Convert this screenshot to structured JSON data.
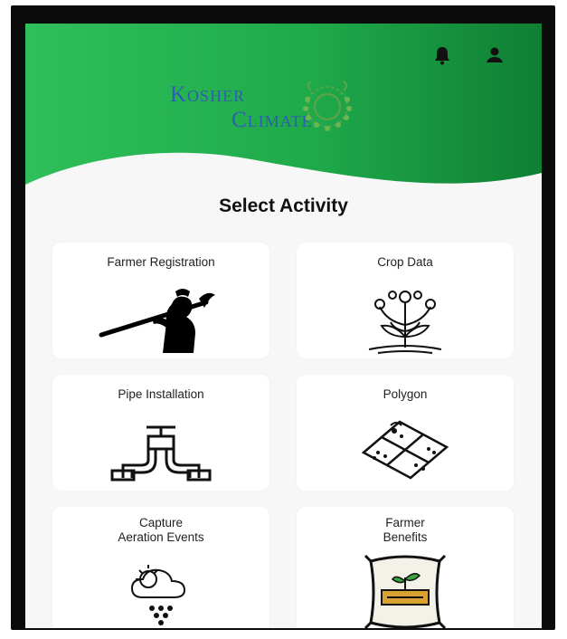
{
  "header": {
    "brand_line1": "Kosher",
    "brand_line2": "Climate",
    "bell_icon": "bell-icon",
    "profile_icon": "user-icon",
    "colors": {
      "green_dark": "#0f8a3a",
      "green_light": "#2fbf5a"
    }
  },
  "page": {
    "title": "Select Activity"
  },
  "activities": [
    {
      "label": "Farmer Registration",
      "icon": "farmer-with-hoe-icon"
    },
    {
      "label": "Crop Data",
      "icon": "plant-icon"
    },
    {
      "label": "Pipe Installation",
      "icon": "pipe-valve-icon"
    },
    {
      "label": "Polygon",
      "icon": "land-map-icon"
    },
    {
      "label_line1": "Capture",
      "label_line2": "Aeration Events",
      "icon": "weather-cloud-icon"
    },
    {
      "label_line1": "Farmer",
      "label_line2": "Benefits",
      "icon": "seed-bag-icon"
    }
  ]
}
